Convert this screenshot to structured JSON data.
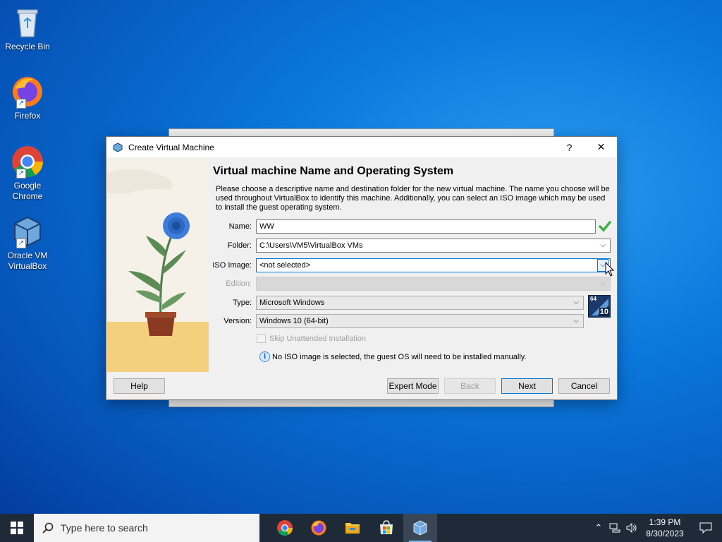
{
  "desktop": {
    "icons": [
      {
        "label": "Recycle Bin",
        "icon": "recycle-bin-icon"
      },
      {
        "label": "Firefox",
        "icon": "firefox-icon"
      },
      {
        "label": "Google Chrome",
        "icon": "chrome-icon"
      },
      {
        "label": "Oracle VM VirtualBox",
        "icon": "virtualbox-icon"
      }
    ]
  },
  "dialog": {
    "title": "Create Virtual Machine",
    "help_glyph": "?",
    "close_glyph": "✕",
    "heading": "Virtual machine Name and Operating System",
    "description": "Please choose a descriptive name and destination folder for the new virtual machine. The name you choose will be used throughout VirtualBox to identify this machine. Additionally, you can select an ISO image which may be used to install the guest operating system.",
    "name_label": "Name:",
    "name_value": "WW",
    "folder_label": "Folder:",
    "folder_value": "C:\\Users\\VM5\\VirtualBox VMs",
    "iso_label": "ISO Image:",
    "iso_value": "<not selected>",
    "edition_label": "Edition:",
    "edition_value": "",
    "type_label": "Type:",
    "type_value": "Microsoft Windows",
    "version_label": "Version:",
    "version_value": "Windows 10 (64-bit)",
    "os_badge_bits": "64",
    "os_badge_ver": "10",
    "skip_unattended_label": "Skip Unattended Installation",
    "skip_unattended_checked": false,
    "info_message": "No ISO image is selected, the guest OS will need to be installed manually.",
    "buttons": {
      "help": "Help",
      "expert": "Expert Mode",
      "back": "Back",
      "next": "Next",
      "cancel": "Cancel"
    }
  },
  "taskbar": {
    "search_placeholder": "Type here to search",
    "apps": [
      "chrome-icon",
      "firefox-icon",
      "file-explorer-icon",
      "store-icon",
      "virtualbox-icon"
    ],
    "time": "1:39 PM",
    "date": "8/30/2023"
  },
  "colors": {
    "accent": "#0078d7",
    "taskbar": "#1f2a38",
    "valid_check": "#3cb043"
  }
}
